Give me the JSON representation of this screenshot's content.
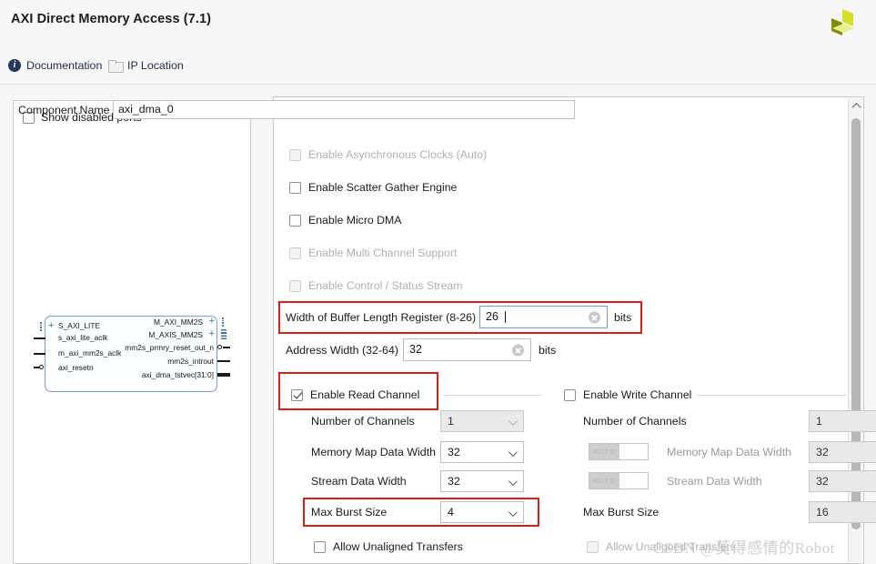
{
  "window": {
    "title": "AXI Direct Memory Access",
    "version": "(7.1)",
    "logo_colors": {
      "dark": "#7f8a0b",
      "mid": "#d6df2a",
      "light": "#e7ef8a"
    }
  },
  "toolbar": {
    "documentation_label": "Documentation",
    "documentation_icon": "info-icon",
    "ip_location_label": "IP Location",
    "ip_location_icon": "folder-icon"
  },
  "left_panel": {
    "show_disabled_ports_label": "Show disabled ports",
    "show_disabled_ports_checked": false,
    "block": {
      "left_ports": [
        "S_AXI_LITE",
        "s_axi_lite_aclk",
        "m_axi_mm2s_aclk",
        "axi_resetn"
      ],
      "right_ports": [
        "M_AXI_MM2S",
        "M_AXIS_MM2S",
        "mm2s_prmry_reset_out_n",
        "mm2s_introut",
        "axi_dma_tstvec[31:0]"
      ]
    }
  },
  "main": {
    "component_name_label": "Component Name",
    "component_name_value": "axi_dma_0",
    "options": [
      {
        "label": "Enable Asynchronous Clocks (Auto)",
        "checked": false,
        "disabled": true
      },
      {
        "label": "Enable Scatter Gather Engine",
        "checked": false,
        "disabled": false
      },
      {
        "label": "Enable Micro DMA",
        "checked": false,
        "disabled": false
      },
      {
        "label": "Enable Multi Channel Support",
        "checked": false,
        "disabled": true
      },
      {
        "label": "Enable Control / Status Stream",
        "checked": false,
        "disabled": true
      }
    ],
    "buffer_length": {
      "label": "Width of Buffer Length Register (8-26)",
      "value": "26",
      "unit": "bits",
      "focused": true,
      "highlighted": true
    },
    "address_width": {
      "label": "Address Width (32-64)",
      "value": "32",
      "unit": "bits",
      "focused": false,
      "highlighted": false
    },
    "read_channel": {
      "group_label": "Enable Read Channel",
      "checked": true,
      "highlighted": true,
      "fields": [
        {
          "label": "Number of Channels",
          "value": "1",
          "disabled": true,
          "highlighted": false
        },
        {
          "label": "Memory Map Data Width",
          "value": "32",
          "disabled": false,
          "highlighted": false
        },
        {
          "label": "Stream Data Width",
          "value": "32",
          "disabled": false,
          "highlighted": false
        },
        {
          "label": "Max Burst Size",
          "value": "4",
          "disabled": false,
          "highlighted": true
        }
      ],
      "allow_unaligned_label": "Allow Unaligned Transfers",
      "allow_unaligned_checked": false,
      "allow_unaligned_disabled": false
    },
    "write_channel": {
      "group_label": "Enable Write Channel",
      "checked": false,
      "fields": [
        {
          "label": "Number of Channels",
          "value": "1",
          "auto": false
        },
        {
          "label": "Memory Map Data Width",
          "value": "32",
          "auto": true,
          "auto_label": "AUTO"
        },
        {
          "label": "Stream Data Width",
          "value": "32",
          "auto": true,
          "auto_label": "AUTO"
        },
        {
          "label": "Max Burst Size",
          "value": "16",
          "auto": false
        }
      ],
      "allow_unaligned_label": "Allow Unaligned Transfers",
      "allow_unaligned_checked": false,
      "allow_unaligned_disabled": true
    }
  },
  "scrollbar": {
    "up_arrow_icon": "chevron-up-icon"
  },
  "watermark": {
    "text": "CSDN @莫得感情的Robot"
  },
  "colors": {
    "highlight": "#e21b13",
    "focus_border": "#6d9ccd",
    "link": "#1f2a44"
  }
}
